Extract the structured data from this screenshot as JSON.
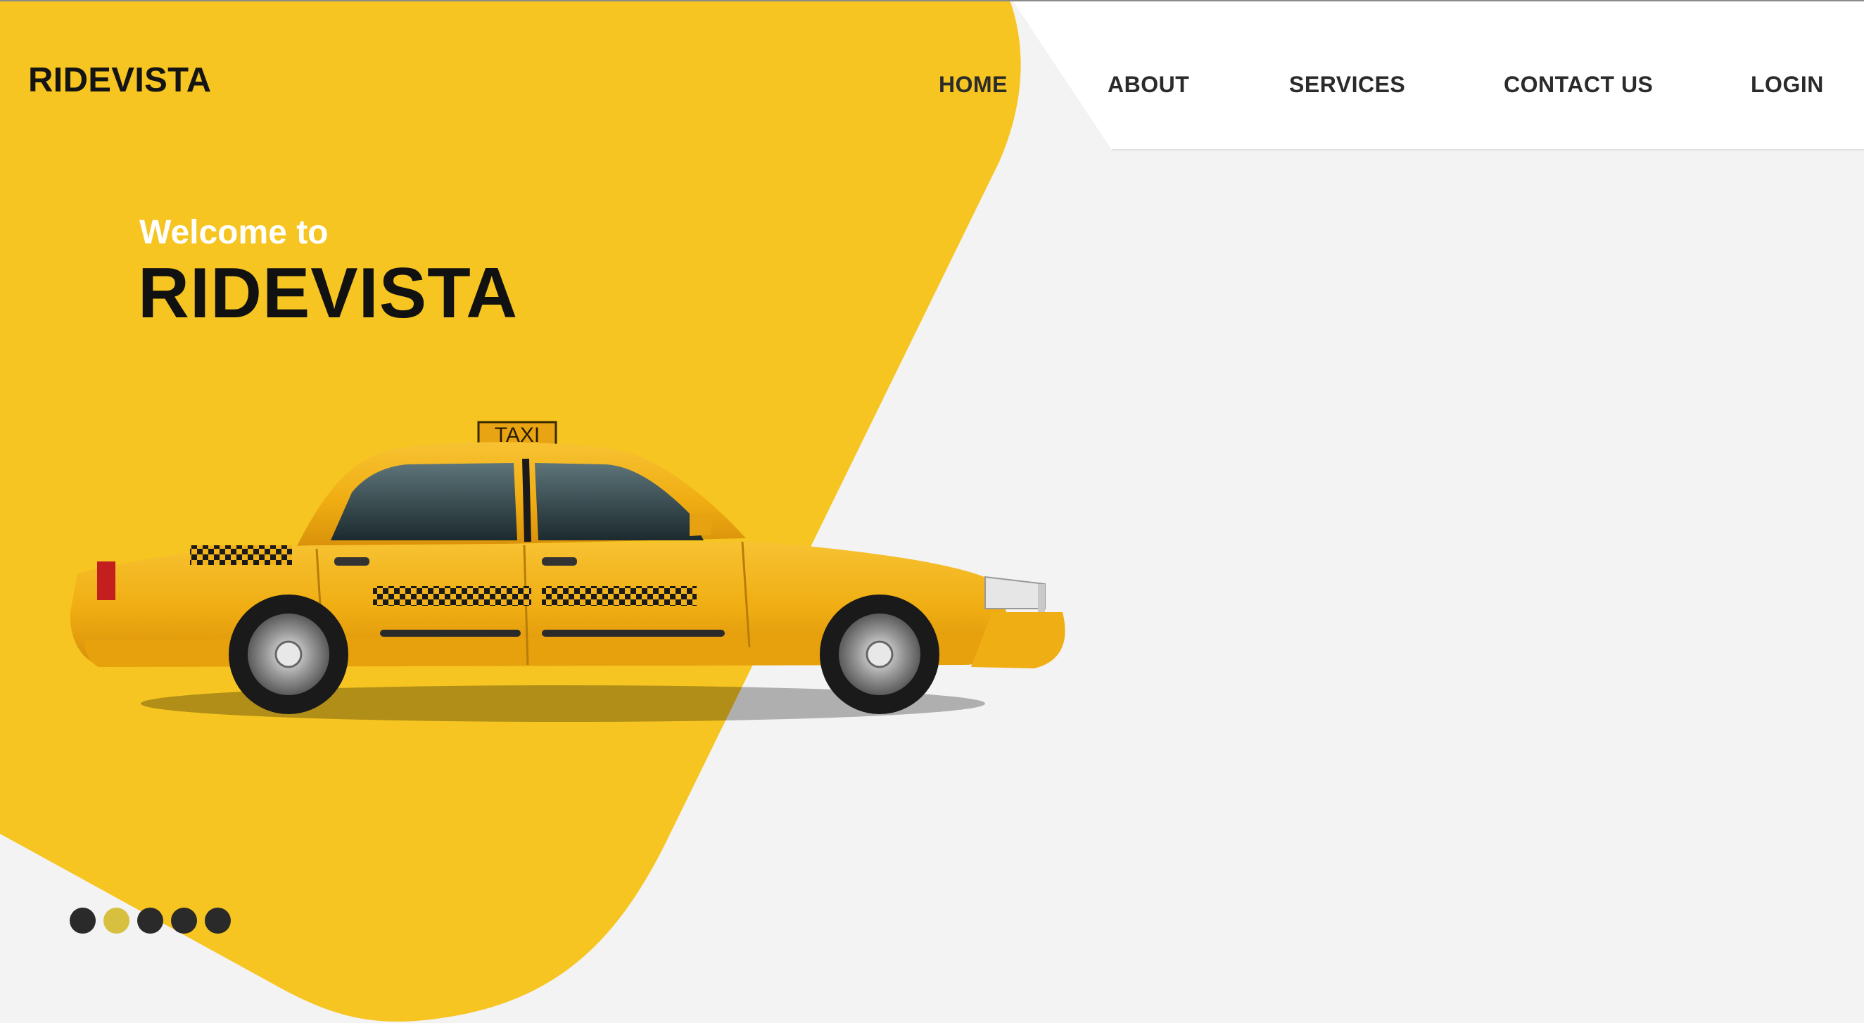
{
  "brand": {
    "name": "RIDEVISTA"
  },
  "nav": {
    "items": [
      {
        "label": "HOME"
      },
      {
        "label": "ABOUT"
      },
      {
        "label": "SERVICES"
      },
      {
        "label": "CONTACT US"
      },
      {
        "label": "LOGIN"
      }
    ]
  },
  "hero": {
    "welcome": "Welcome to",
    "title": "RIDEVISTA",
    "sign_text": "TAXI"
  },
  "carousel": {
    "slide_count": 5,
    "active_index": 1
  },
  "colors": {
    "accent": "#F6C521",
    "background": "#F3F3F3",
    "header": "#FFFFFF",
    "text_dark": "#141414",
    "dot_active": "#D7C040",
    "dot_inactive": "#2A2A2A"
  },
  "icons": [
    "taxi-car-illustration"
  ]
}
